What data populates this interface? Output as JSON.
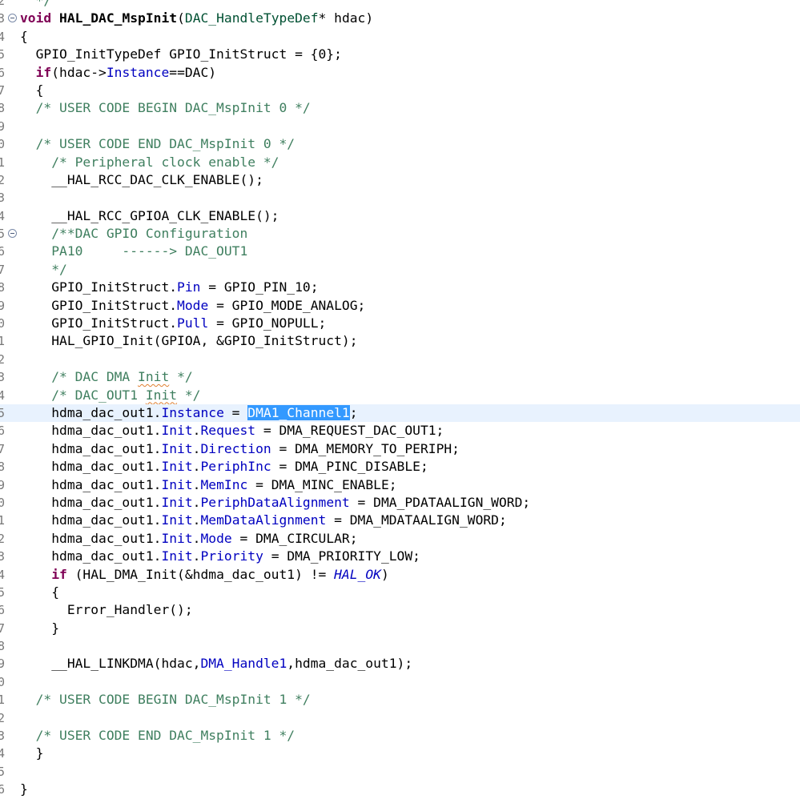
{
  "lines": [
    {
      "num": "2",
      "tokens": [
        {
          "t": "  */",
          "c": "cm"
        }
      ]
    },
    {
      "num": "3",
      "fold": true,
      "tokens": [
        {
          "t": "void",
          "c": "kw"
        },
        {
          "t": " "
        },
        {
          "t": "HAL_DAC_MspInit",
          "c": "b"
        },
        {
          "t": "("
        },
        {
          "t": "DAC_HandleTypeDef",
          "c": "ty"
        },
        {
          "t": "* hdac)"
        }
      ]
    },
    {
      "num": "4",
      "tokens": [
        {
          "t": "{"
        }
      ]
    },
    {
      "num": "5",
      "tokens": [
        {
          "t": "  GPIO_InitTypeDef GPIO_InitStruct = {0};"
        }
      ]
    },
    {
      "num": "6",
      "tokens": [
        {
          "t": "  "
        },
        {
          "t": "if",
          "c": "kw"
        },
        {
          "t": "(hdac->"
        },
        {
          "t": "Instance",
          "c": "fld"
        },
        {
          "t": "==DAC)"
        }
      ]
    },
    {
      "num": "7",
      "tokens": [
        {
          "t": "  {"
        }
      ]
    },
    {
      "num": "8",
      "tokens": [
        {
          "t": "  /* USER CODE BEGIN DAC_MspInit 0 */",
          "c": "cm"
        }
      ]
    },
    {
      "num": "9",
      "tokens": []
    },
    {
      "num": "0",
      "tokens": [
        {
          "t": "  /* USER CODE END DAC_MspInit 0 */",
          "c": "cm"
        }
      ]
    },
    {
      "num": "1",
      "tokens": [
        {
          "t": "    /* Peripheral clock enable */",
          "c": "cm"
        }
      ]
    },
    {
      "num": "2",
      "tokens": [
        {
          "t": "    __HAL_RCC_DAC_CLK_ENABLE();"
        }
      ]
    },
    {
      "num": "3",
      "tokens": []
    },
    {
      "num": "4",
      "tokens": [
        {
          "t": "    __HAL_RCC_GPIOA_CLK_ENABLE();"
        }
      ]
    },
    {
      "num": "5",
      "fold": true,
      "tokens": [
        {
          "t": "    /**DAC GPIO Configuration",
          "c": "cm"
        }
      ]
    },
    {
      "num": "6",
      "tokens": [
        {
          "t": "    PA10     ------> DAC_OUT1",
          "c": "cm"
        }
      ]
    },
    {
      "num": "7",
      "tokens": [
        {
          "t": "    */",
          "c": "cm"
        }
      ]
    },
    {
      "num": "8",
      "tokens": [
        {
          "t": "    GPIO_InitStruct."
        },
        {
          "t": "Pin",
          "c": "fld"
        },
        {
          "t": " = GPIO_PIN_10;"
        }
      ]
    },
    {
      "num": "9",
      "tokens": [
        {
          "t": "    GPIO_InitStruct."
        },
        {
          "t": "Mode",
          "c": "fld"
        },
        {
          "t": " = GPIO_MODE_ANALOG;"
        }
      ]
    },
    {
      "num": "0",
      "tokens": [
        {
          "t": "    GPIO_InitStruct."
        },
        {
          "t": "Pull",
          "c": "fld"
        },
        {
          "t": " = GPIO_NOPULL;"
        }
      ]
    },
    {
      "num": "1",
      "tokens": [
        {
          "t": "    HAL_GPIO_Init(GPIOA, &GPIO_InitStruct);"
        }
      ]
    },
    {
      "num": "2",
      "tokens": []
    },
    {
      "num": "3",
      "tokens": [
        {
          "t": "    /* DAC DMA ",
          "c": "cm"
        },
        {
          "t": "Init",
          "c": "cm squig"
        },
        {
          "t": " */",
          "c": "cm"
        }
      ]
    },
    {
      "num": "4",
      "tokens": [
        {
          "t": "    /* DAC_OUT1 ",
          "c": "cm"
        },
        {
          "t": "Init",
          "c": "cm squig"
        },
        {
          "t": " */",
          "c": "cm"
        }
      ]
    },
    {
      "num": "5",
      "current": true,
      "tokens": [
        {
          "t": "    hdma_dac_out1."
        },
        {
          "t": "Instance",
          "c": "fld"
        },
        {
          "t": " = "
        },
        {
          "t": "DMA1_Channel1",
          "c": "sel"
        },
        {
          "t": ";"
        }
      ]
    },
    {
      "num": "6",
      "tokens": [
        {
          "t": "    hdma_dac_out1."
        },
        {
          "t": "Init",
          "c": "fld"
        },
        {
          "t": "."
        },
        {
          "t": "Request",
          "c": "fld"
        },
        {
          "t": " = DMA_REQUEST_DAC_OUT1;"
        }
      ]
    },
    {
      "num": "7",
      "tokens": [
        {
          "t": "    hdma_dac_out1."
        },
        {
          "t": "Init",
          "c": "fld"
        },
        {
          "t": "."
        },
        {
          "t": "Direction",
          "c": "fld"
        },
        {
          "t": " = DMA_MEMORY_TO_PERIPH;"
        }
      ]
    },
    {
      "num": "8",
      "tokens": [
        {
          "t": "    hdma_dac_out1."
        },
        {
          "t": "Init",
          "c": "fld"
        },
        {
          "t": "."
        },
        {
          "t": "PeriphInc",
          "c": "fld"
        },
        {
          "t": " = DMA_PINC_DISABLE;"
        }
      ]
    },
    {
      "num": "9",
      "tokens": [
        {
          "t": "    hdma_dac_out1."
        },
        {
          "t": "Init",
          "c": "fld"
        },
        {
          "t": "."
        },
        {
          "t": "MemInc",
          "c": "fld"
        },
        {
          "t": " = DMA_MINC_ENABLE;"
        }
      ]
    },
    {
      "num": "0",
      "tokens": [
        {
          "t": "    hdma_dac_out1."
        },
        {
          "t": "Init",
          "c": "fld"
        },
        {
          "t": "."
        },
        {
          "t": "PeriphDataAlignment",
          "c": "fld"
        },
        {
          "t": " = DMA_PDATAALIGN_WORD;"
        }
      ]
    },
    {
      "num": "1",
      "tokens": [
        {
          "t": "    hdma_dac_out1."
        },
        {
          "t": "Init",
          "c": "fld"
        },
        {
          "t": "."
        },
        {
          "t": "MemDataAlignment",
          "c": "fld"
        },
        {
          "t": " = DMA_MDATAALIGN_WORD;"
        }
      ]
    },
    {
      "num": "2",
      "tokens": [
        {
          "t": "    hdma_dac_out1."
        },
        {
          "t": "Init",
          "c": "fld"
        },
        {
          "t": "."
        },
        {
          "t": "Mode",
          "c": "fld"
        },
        {
          "t": " = DMA_CIRCULAR;"
        }
      ]
    },
    {
      "num": "3",
      "tokens": [
        {
          "t": "    hdma_dac_out1."
        },
        {
          "t": "Init",
          "c": "fld"
        },
        {
          "t": "."
        },
        {
          "t": "Priority",
          "c": "fld"
        },
        {
          "t": " = DMA_PRIORITY_LOW;"
        }
      ]
    },
    {
      "num": "4",
      "tokens": [
        {
          "t": "    "
        },
        {
          "t": "if",
          "c": "kw"
        },
        {
          "t": " (HAL_DMA_Init(&hdma_dac_out1) != "
        },
        {
          "t": "HAL_OK",
          "c": "it"
        },
        {
          "t": ")"
        }
      ]
    },
    {
      "num": "5",
      "tokens": [
        {
          "t": "    {"
        }
      ]
    },
    {
      "num": "6",
      "tokens": [
        {
          "t": "      Error_Handler();"
        }
      ]
    },
    {
      "num": "7",
      "tokens": [
        {
          "t": "    }"
        }
      ]
    },
    {
      "num": "8",
      "tokens": []
    },
    {
      "num": "9",
      "tokens": [
        {
          "t": "    __HAL_LINKDMA(hdac,"
        },
        {
          "t": "DMA_Handle1",
          "c": "fld"
        },
        {
          "t": ",hdma_dac_out1);"
        }
      ]
    },
    {
      "num": "0",
      "tokens": []
    },
    {
      "num": "1",
      "tokens": [
        {
          "t": "  /* USER CODE BEGIN DAC_MspInit 1 */",
          "c": "cm"
        }
      ]
    },
    {
      "num": "2",
      "tokens": []
    },
    {
      "num": "3",
      "tokens": [
        {
          "t": "  /* USER CODE END DAC_MspInit 1 */",
          "c": "cm"
        }
      ]
    },
    {
      "num": "4",
      "tokens": [
        {
          "t": "  }"
        }
      ]
    },
    {
      "num": "5",
      "tokens": []
    },
    {
      "num": "6",
      "tokens": [
        {
          "t": "}"
        }
      ]
    }
  ]
}
